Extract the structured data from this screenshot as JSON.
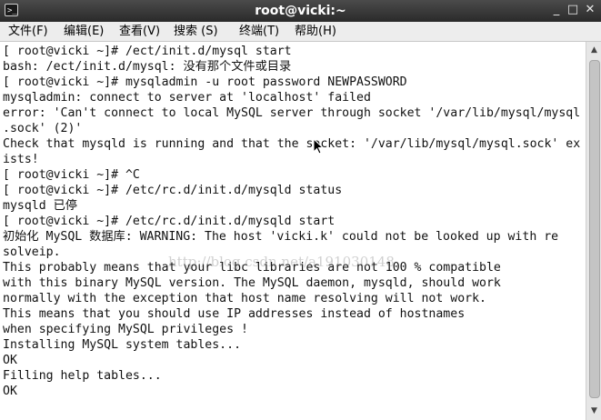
{
  "window": {
    "title": "root@vicki:~",
    "app_icon_glyph": ">_",
    "buttons": {
      "minimize": "_",
      "maximize": "□",
      "close": "✕"
    }
  },
  "menu": [
    "文件(F)",
    "编辑(E)",
    "查看(V)",
    "搜索 (S)",
    "终端(T)",
    "帮助(H)"
  ],
  "terminal_lines": [
    "[ root@vicki ~]# /ect/init.d/mysql start",
    "bash: /ect/init.d/mysql: 没有那个文件或目录",
    "[ root@vicki ~]# mysqladmin -u root password NEWPASSWORD",
    "mysqladmin: connect to server at 'localhost' failed",
    "error: 'Can't connect to local MySQL server through socket '/var/lib/mysql/mysql",
    ".sock' (2)'",
    "Check that mysqld is running and that the socket: '/var/lib/mysql/mysql.sock' ex",
    "ists!",
    "[ root@vicki ~]# ^C",
    "[ root@vicki ~]# /etc/rc.d/init.d/mysqld status",
    "mysqld 已停",
    "[ root@vicki ~]# /etc/rc.d/init.d/mysqld start",
    "初始化 MySQL 数据库: WARNING: The host 'vicki.k' could not be looked up with re",
    "solveip.",
    "This probably means that your libc libraries are not 100 % compatible",
    "with this binary MySQL version. The MySQL daemon, mysqld, should work",
    "normally with the exception that host name resolving will not work.",
    "This means that you should use IP addresses instead of hostnames",
    "when specifying MySQL privileges !",
    "Installing MySQL system tables...",
    "OK",
    "Filling help tables...",
    "OK"
  ],
  "watermark": "http://blog.csdn.net/a191030148",
  "icons": {
    "app": "terminal-icon",
    "scroll_up": "arrow-up-icon",
    "scroll_down": "arrow-down-icon",
    "pointer": "mouse-pointer-icon"
  },
  "colors": {
    "titlebar": "#3a3a3a",
    "menubar": "#ededed",
    "terminal_bg": "#ffffff",
    "terminal_fg": "#111111"
  }
}
